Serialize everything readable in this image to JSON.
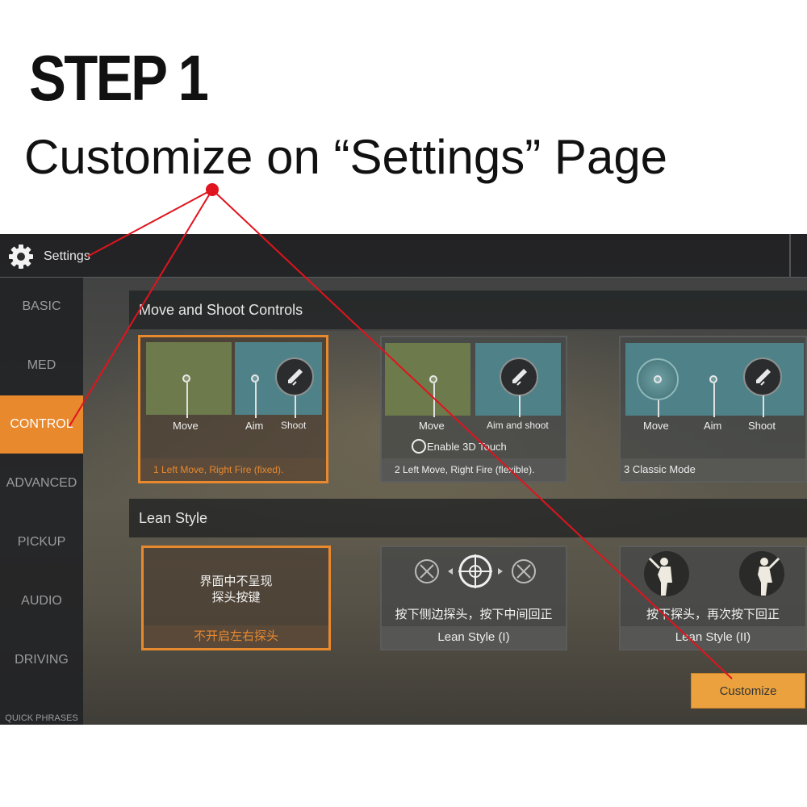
{
  "heading": {
    "step": "STEP 1",
    "subtitle": "Customize on “Settings” Page"
  },
  "topbar": {
    "title": "Settings",
    "icon": "gear-icon"
  },
  "sidebar": {
    "items": [
      {
        "label": "BASIC"
      },
      {
        "label": "MED"
      },
      {
        "label": "CONTROL",
        "active": true
      },
      {
        "label": "ADVANCED"
      },
      {
        "label": "PICKUP"
      },
      {
        "label": "AUDIO"
      },
      {
        "label": "DRIVING"
      },
      {
        "label": "QUICK PHRASES"
      }
    ]
  },
  "move_shoot": {
    "header": "Move and Shoot Controls",
    "options": [
      {
        "labels": [
          "Move",
          "Aim",
          "Shoot"
        ],
        "footer": "1  Left Move, Right Fire (fixed).",
        "selected": true
      },
      {
        "labels": [
          "Move",
          "Aim and shoot"
        ],
        "touch": "Enable 3D Touch",
        "footer": "2 Left Move, Right Fire (flexible).",
        "selected": false
      },
      {
        "labels": [
          "Move",
          "Aim",
          "Shoot"
        ],
        "footer": "3 Classic Mode",
        "selected": false
      }
    ]
  },
  "lean": {
    "header": "Lean Style",
    "options": [
      {
        "line1": "界面中不呈现",
        "line2": "探头按键",
        "footer": "不开启左右探头",
        "selected": true
      },
      {
        "text": "按下侧边探头，按下中间回正",
        "footer": "Lean Style (I)",
        "selected": false
      },
      {
        "text": "按下探头，再次按下回正",
        "footer": "Lean Style (II)",
        "selected": false
      }
    ]
  },
  "customize_button": "Customize",
  "colors": {
    "accent": "#e8892e",
    "annotation": "#e0141e",
    "button": "#eba23e"
  }
}
